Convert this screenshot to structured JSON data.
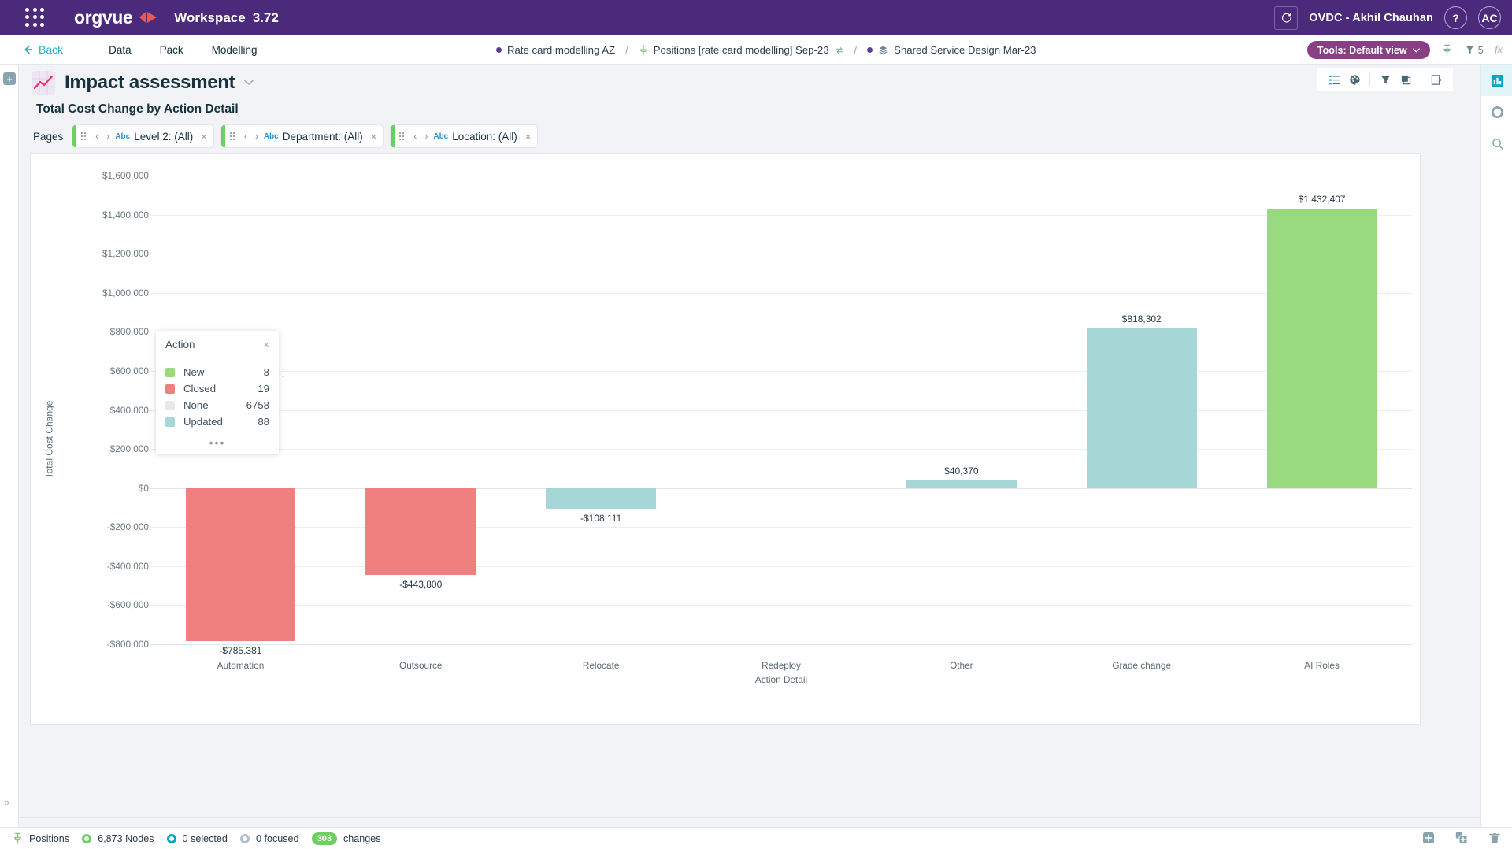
{
  "app": {
    "brand": "orgvue",
    "workspace_label": "Workspace",
    "version": "3.72",
    "user": "OVDC - Akhil Chauhan",
    "avatar_initials": "AC",
    "help_label": "?"
  },
  "toolbar": {
    "back_label": "Back",
    "menu": [
      "Data",
      "Pack",
      "Modelling"
    ],
    "tools_label": "Tools: Default view",
    "notification_count": "5",
    "fx_label": "fx"
  },
  "breadcrumb": [
    {
      "label": "Rate card modelling AZ",
      "icon": "dot-icon"
    },
    {
      "label": "Positions [rate card modelling] Sep-23",
      "icon": "pin-icon"
    },
    {
      "label": "Shared Service Design Mar-23",
      "icon": "layers-icon"
    }
  ],
  "page": {
    "title": "Impact assessment",
    "subtitle": "Total Cost Change by Action Detail",
    "pages_label": "Pages"
  },
  "filters": [
    {
      "type": "Abc",
      "label": "Level 2: (All)"
    },
    {
      "type": "Abc",
      "label": "Department: (All)"
    },
    {
      "type": "Abc",
      "label": "Location: (All)"
    }
  ],
  "chart_toolbar": [
    "list-icon",
    "palette-icon",
    "filter-icon",
    "layers-square-icon",
    "export-icon"
  ],
  "right_rail": [
    "bar-chart-icon",
    "target-icon",
    "search-icon"
  ],
  "legend": {
    "title": "Action",
    "close_label": "×",
    "more_label": "•••",
    "rows": [
      {
        "label": "New",
        "value": "8",
        "color": "#9ada7f"
      },
      {
        "label": "Closed",
        "value": "19",
        "color": "#f08080"
      },
      {
        "label": "None",
        "value": "6758",
        "color": "#e9e9e9"
      },
      {
        "label": "Updated",
        "value": "88",
        "color": "#a6d6d6"
      }
    ]
  },
  "chart_data": {
    "type": "bar",
    "title": "Total Cost Change by Action Detail",
    "xlabel": "Action Detail",
    "ylabel": "Total Cost Change",
    "categories": [
      "Automation",
      "Outsource",
      "Relocate",
      "Redeploy",
      "Other",
      "Grade change",
      "AI Roles"
    ],
    "values": [
      -785381,
      -443800,
      -108111,
      0,
      40370,
      818302,
      1432407
    ],
    "value_labels": [
      "-$785,381",
      "-$443,800",
      "-$108,111",
      "",
      "$40,370",
      "$818,302",
      "$1,432,407"
    ],
    "bar_colors": [
      "#f08080",
      "#f08080",
      "#a6d6d6",
      "#a6d6d6",
      "#a6d6d6",
      "#a6d6d6",
      "#9ada7f"
    ],
    "ylim": [
      -800000,
      1600000
    ],
    "yticks": [
      1600000,
      1400000,
      1200000,
      1000000,
      800000,
      600000,
      400000,
      200000,
      0,
      -200000,
      -400000,
      -600000,
      -800000
    ],
    "ytick_labels": [
      "$1,600,000",
      "$1,400,000",
      "$1,200,000",
      "$1,000,000",
      "$800,000",
      "$600,000",
      "$400,000",
      "$200,000",
      "$0",
      "-$200,000",
      "-$400,000",
      "-$600,000",
      "-$800,000"
    ],
    "grid": true,
    "legend_position": "inside-top-left"
  },
  "status_bar": {
    "entity": "Positions",
    "nodes": "6,873 Nodes",
    "selected": "0 selected",
    "focused": "0 focused",
    "changes_count": "303",
    "changes_label": "changes",
    "actions": [
      "add-icon",
      "duplicate-icon",
      "delete-icon"
    ]
  }
}
